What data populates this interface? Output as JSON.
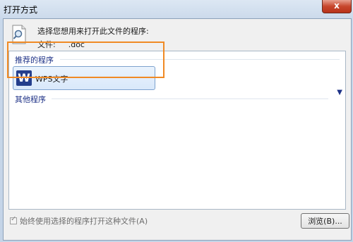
{
  "window": {
    "title": "打开方式",
    "close_label": "x"
  },
  "dialog": {
    "prompt": "选择您想用来打开此文件的程序:",
    "file_label": "文件:",
    "file_name": ".doc"
  },
  "groups": {
    "recommended_header": "推荐的程序",
    "other_header": "其他程序"
  },
  "programs": [
    {
      "name": "WPS文字",
      "icon": "wps-writer-icon",
      "icon_glyph": "W"
    }
  ],
  "footer": {
    "always_use_label": "始终使用选择的程序打开这种文件(A)",
    "always_use_checked": true,
    "browse_label": "浏览(B)..."
  },
  "colors": {
    "highlight": "#f08a24",
    "group_header": "#1e3287",
    "wps_icon": "#243e8c"
  }
}
